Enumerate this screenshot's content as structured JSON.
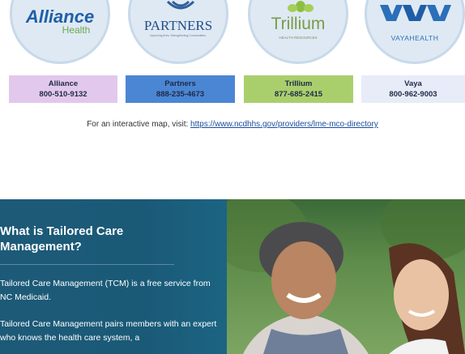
{
  "logos": {
    "alliance": {
      "name": "Alliance",
      "sub": "Health"
    },
    "partners": {
      "name": "PARTNERS",
      "tagline": "Improving lives. Strengthening Communities."
    },
    "trillium": {
      "name": "Trillium",
      "sub": "HEALTH RESOURCES"
    },
    "vaya": {
      "name": "VAYAHEALTH"
    }
  },
  "contacts": [
    {
      "name": "Alliance",
      "phone": "800-510-9132",
      "color": "#e2c8ec"
    },
    {
      "name": "Partners",
      "phone": "888-235-4673",
      "color": "#4a86d4"
    },
    {
      "name": "Trillium",
      "phone": "877-685-2415",
      "color": "#a9cf6d"
    },
    {
      "name": "Vaya",
      "phone": "800-962-9003",
      "color": "#e7ecf8"
    }
  ],
  "map": {
    "text": "For an interactive map, visit:",
    "link": "https://www.ncdhhs.gov/providers/lme-mco-directory"
  },
  "tcm": {
    "title": "What is Tailored Care Management?",
    "p1": "Tailored Care Management (TCM) is a free service from NC Medicaid.",
    "p2": "Tailored Care Management pairs members with an expert who knows the health care system, a"
  }
}
